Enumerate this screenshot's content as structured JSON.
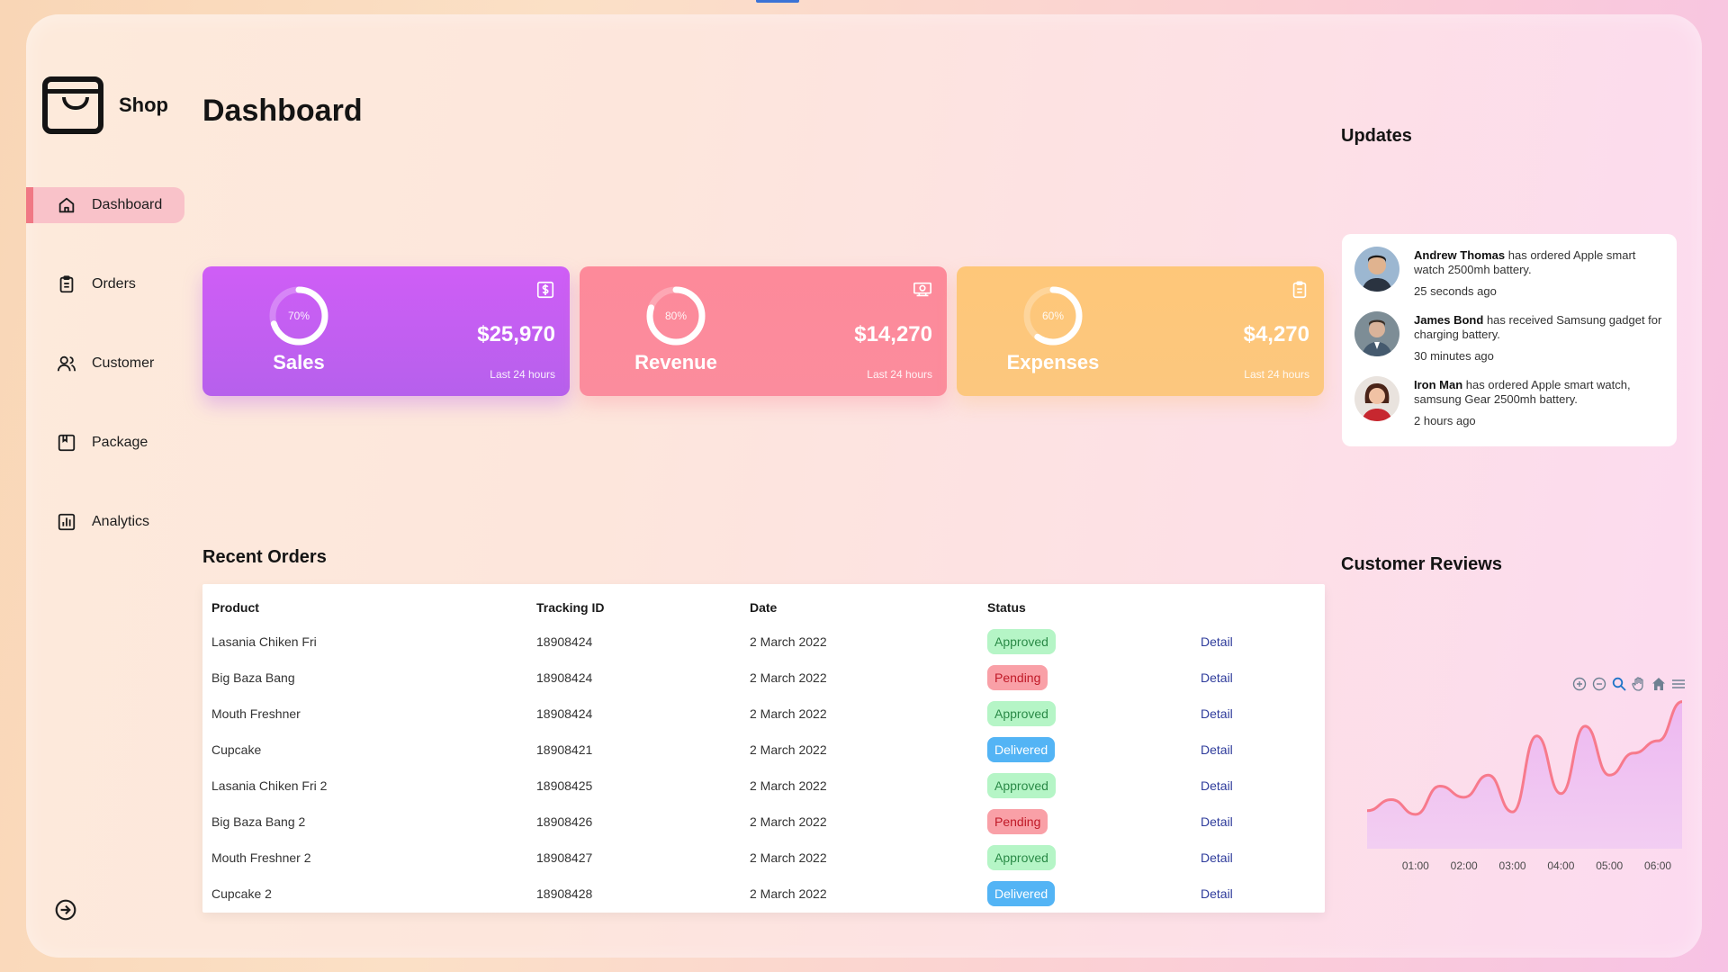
{
  "app": {
    "name": "Shop"
  },
  "page": {
    "title": "Dashboard"
  },
  "nav": [
    {
      "label": "Dashboard",
      "icon": "home-icon",
      "active": true
    },
    {
      "label": "Orders",
      "icon": "clipboard-icon"
    },
    {
      "label": "Customer",
      "icon": "users-icon"
    },
    {
      "label": "Package",
      "icon": "package-icon"
    },
    {
      "label": "Analytics",
      "icon": "bar-chart-icon"
    }
  ],
  "cards": [
    {
      "name": "Sales",
      "percent": 70,
      "percent_label": "70%",
      "value": "$25,970",
      "sub": "Last 24 hours",
      "icon": "dollar-icon"
    },
    {
      "name": "Revenue",
      "percent": 80,
      "percent_label": "80%",
      "value": "$14,270",
      "sub": "Last 24 hours",
      "icon": "money-icon"
    },
    {
      "name": "Expenses",
      "percent": 60,
      "percent_label": "60%",
      "value": "$4,270",
      "sub": "Last 24 hours",
      "icon": "clipboard-icon"
    }
  ],
  "orders": {
    "title": "Recent Orders",
    "headers": [
      "Product",
      "Tracking ID",
      "Date",
      "Status",
      ""
    ],
    "rows": [
      {
        "product": "Lasania Chiken Fri",
        "tracking": "18908424",
        "date": "2 March 2022",
        "status": "Approved",
        "action": "Detail"
      },
      {
        "product": "Big Baza Bang",
        "tracking": "18908424",
        "date": "2 March 2022",
        "status": "Pending",
        "action": "Detail"
      },
      {
        "product": "Mouth Freshner",
        "tracking": "18908424",
        "date": "2 March 2022",
        "status": "Approved",
        "action": "Detail"
      },
      {
        "product": "Cupcake",
        "tracking": "18908421",
        "date": "2 March 2022",
        "status": "Delivered",
        "action": "Detail"
      },
      {
        "product": "Lasania Chiken Fri 2",
        "tracking": "18908425",
        "date": "2 March 2022",
        "status": "Approved",
        "action": "Detail"
      },
      {
        "product": "Big Baza Bang 2",
        "tracking": "18908426",
        "date": "2 March 2022",
        "status": "Pending",
        "action": "Detail"
      },
      {
        "product": "Mouth Freshner 2",
        "tracking": "18908427",
        "date": "2 March 2022",
        "status": "Approved",
        "action": "Detail"
      },
      {
        "product": "Cupcake 2",
        "tracking": "18908428",
        "date": "2 March 2022",
        "status": "Delivered",
        "action": "Detail"
      }
    ]
  },
  "updates": {
    "title": "Updates",
    "items": [
      {
        "name": "Andrew Thomas",
        "text": "has ordered Apple smart watch 2500mh battery.",
        "time": "25 seconds ago"
      },
      {
        "name": "James Bond",
        "text": "has received Samsung gadget for charging battery.",
        "time": "30 minutes ago"
      },
      {
        "name": "Iron Man",
        "text": "has ordered Apple smart watch, samsung Gear 2500mh battery.",
        "time": "2 hours ago"
      }
    ]
  },
  "reviews": {
    "title": "Customer Reviews",
    "toolbar": [
      "zoom-in-icon",
      "zoom-out-icon",
      "magnifier-icon",
      "pan-hand-icon",
      "home-icon",
      "menu-icon"
    ]
  },
  "chart_data": {
    "type": "area",
    "x": [
      "00:00",
      "00:30",
      "01:00",
      "01:30",
      "02:00",
      "02:30",
      "03:00",
      "03:30",
      "04:00",
      "04:30",
      "05:00",
      "05:30",
      "06:00",
      "06:30"
    ],
    "tick_labels": [
      "01:00",
      "02:00",
      "03:00",
      "04:00",
      "05:00",
      "06:00"
    ],
    "series": [
      {
        "values": [
          31,
          40,
          28,
          51,
          42,
          60,
          30,
          92,
          45,
          100,
          60,
          78,
          88,
          120
        ]
      }
    ],
    "ylim": [
      0,
      130
    ],
    "grid": false,
    "colors": {
      "line": "#f77a8c",
      "fill_top": "#e9b2f0",
      "fill_bottom": "#efc8f3"
    }
  },
  "colors": {
    "sales": "#cd5ef5",
    "revenue": "#fd8b9b",
    "expenses": "#fec77a",
    "approved_bg": "#b5f5c6",
    "pending_bg": "#f9a0a7",
    "delivered_bg": "#53b4f5",
    "detail_link": "#2e3b9b",
    "active_nav": "#f9c2c9"
  }
}
